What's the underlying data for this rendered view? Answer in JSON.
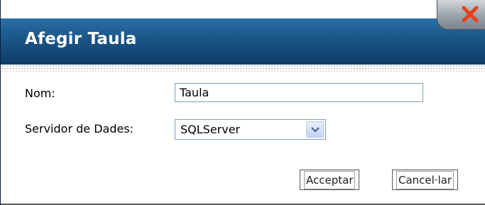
{
  "dialog": {
    "title": "Afegir Taula",
    "close_icon": "close-icon"
  },
  "form": {
    "name_label": "Nom:",
    "name_value": "Taula",
    "server_label": "Servidor de Dades:",
    "server_selected": "SQLServer"
  },
  "buttons": {
    "accept_label": "Acceptar",
    "cancel_label": "Cancel·lar"
  },
  "colors": {
    "title_bar": "#1a5587",
    "close_x": "#e4401e"
  }
}
